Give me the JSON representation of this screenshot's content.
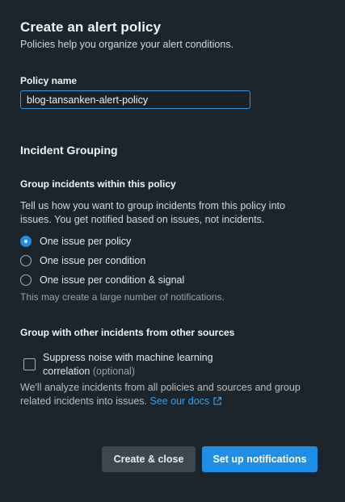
{
  "header": {
    "title": "Create an alert policy",
    "subtitle": "Policies help you organize your alert conditions."
  },
  "policy_name": {
    "label": "Policy name",
    "value": "blog-tansanken-alert-policy"
  },
  "incident_grouping": {
    "title": "Incident Grouping",
    "group_within": {
      "label": "Group incidents within this policy",
      "description": "Tell us how you want to group incidents from this policy into issues. You get notified based on issues, not incidents.",
      "options": [
        {
          "label": "One issue per policy",
          "checked": true
        },
        {
          "label": "One issue per condition",
          "checked": false
        },
        {
          "label": "One issue per condition & signal",
          "checked": false
        }
      ],
      "hint": "This may create a large number of notifications."
    },
    "group_other": {
      "label": "Group with other incidents from other sources",
      "checkbox_label": "Suppress noise with machine learning correlation",
      "checkbox_optional": "(optional)",
      "checked": false,
      "description": "We'll analyze incidents from all policies and sources and group related incidents into issues.",
      "docs_link": "See our docs",
      "docs_icon": "external-link-icon"
    }
  },
  "footer": {
    "secondary_button": "Create & close",
    "primary_button": "Set up notifications"
  },
  "colors": {
    "background": "#1d252c",
    "accent": "#1f8ee6",
    "link": "#3ba0ec",
    "secondary_button": "#3c474f"
  }
}
